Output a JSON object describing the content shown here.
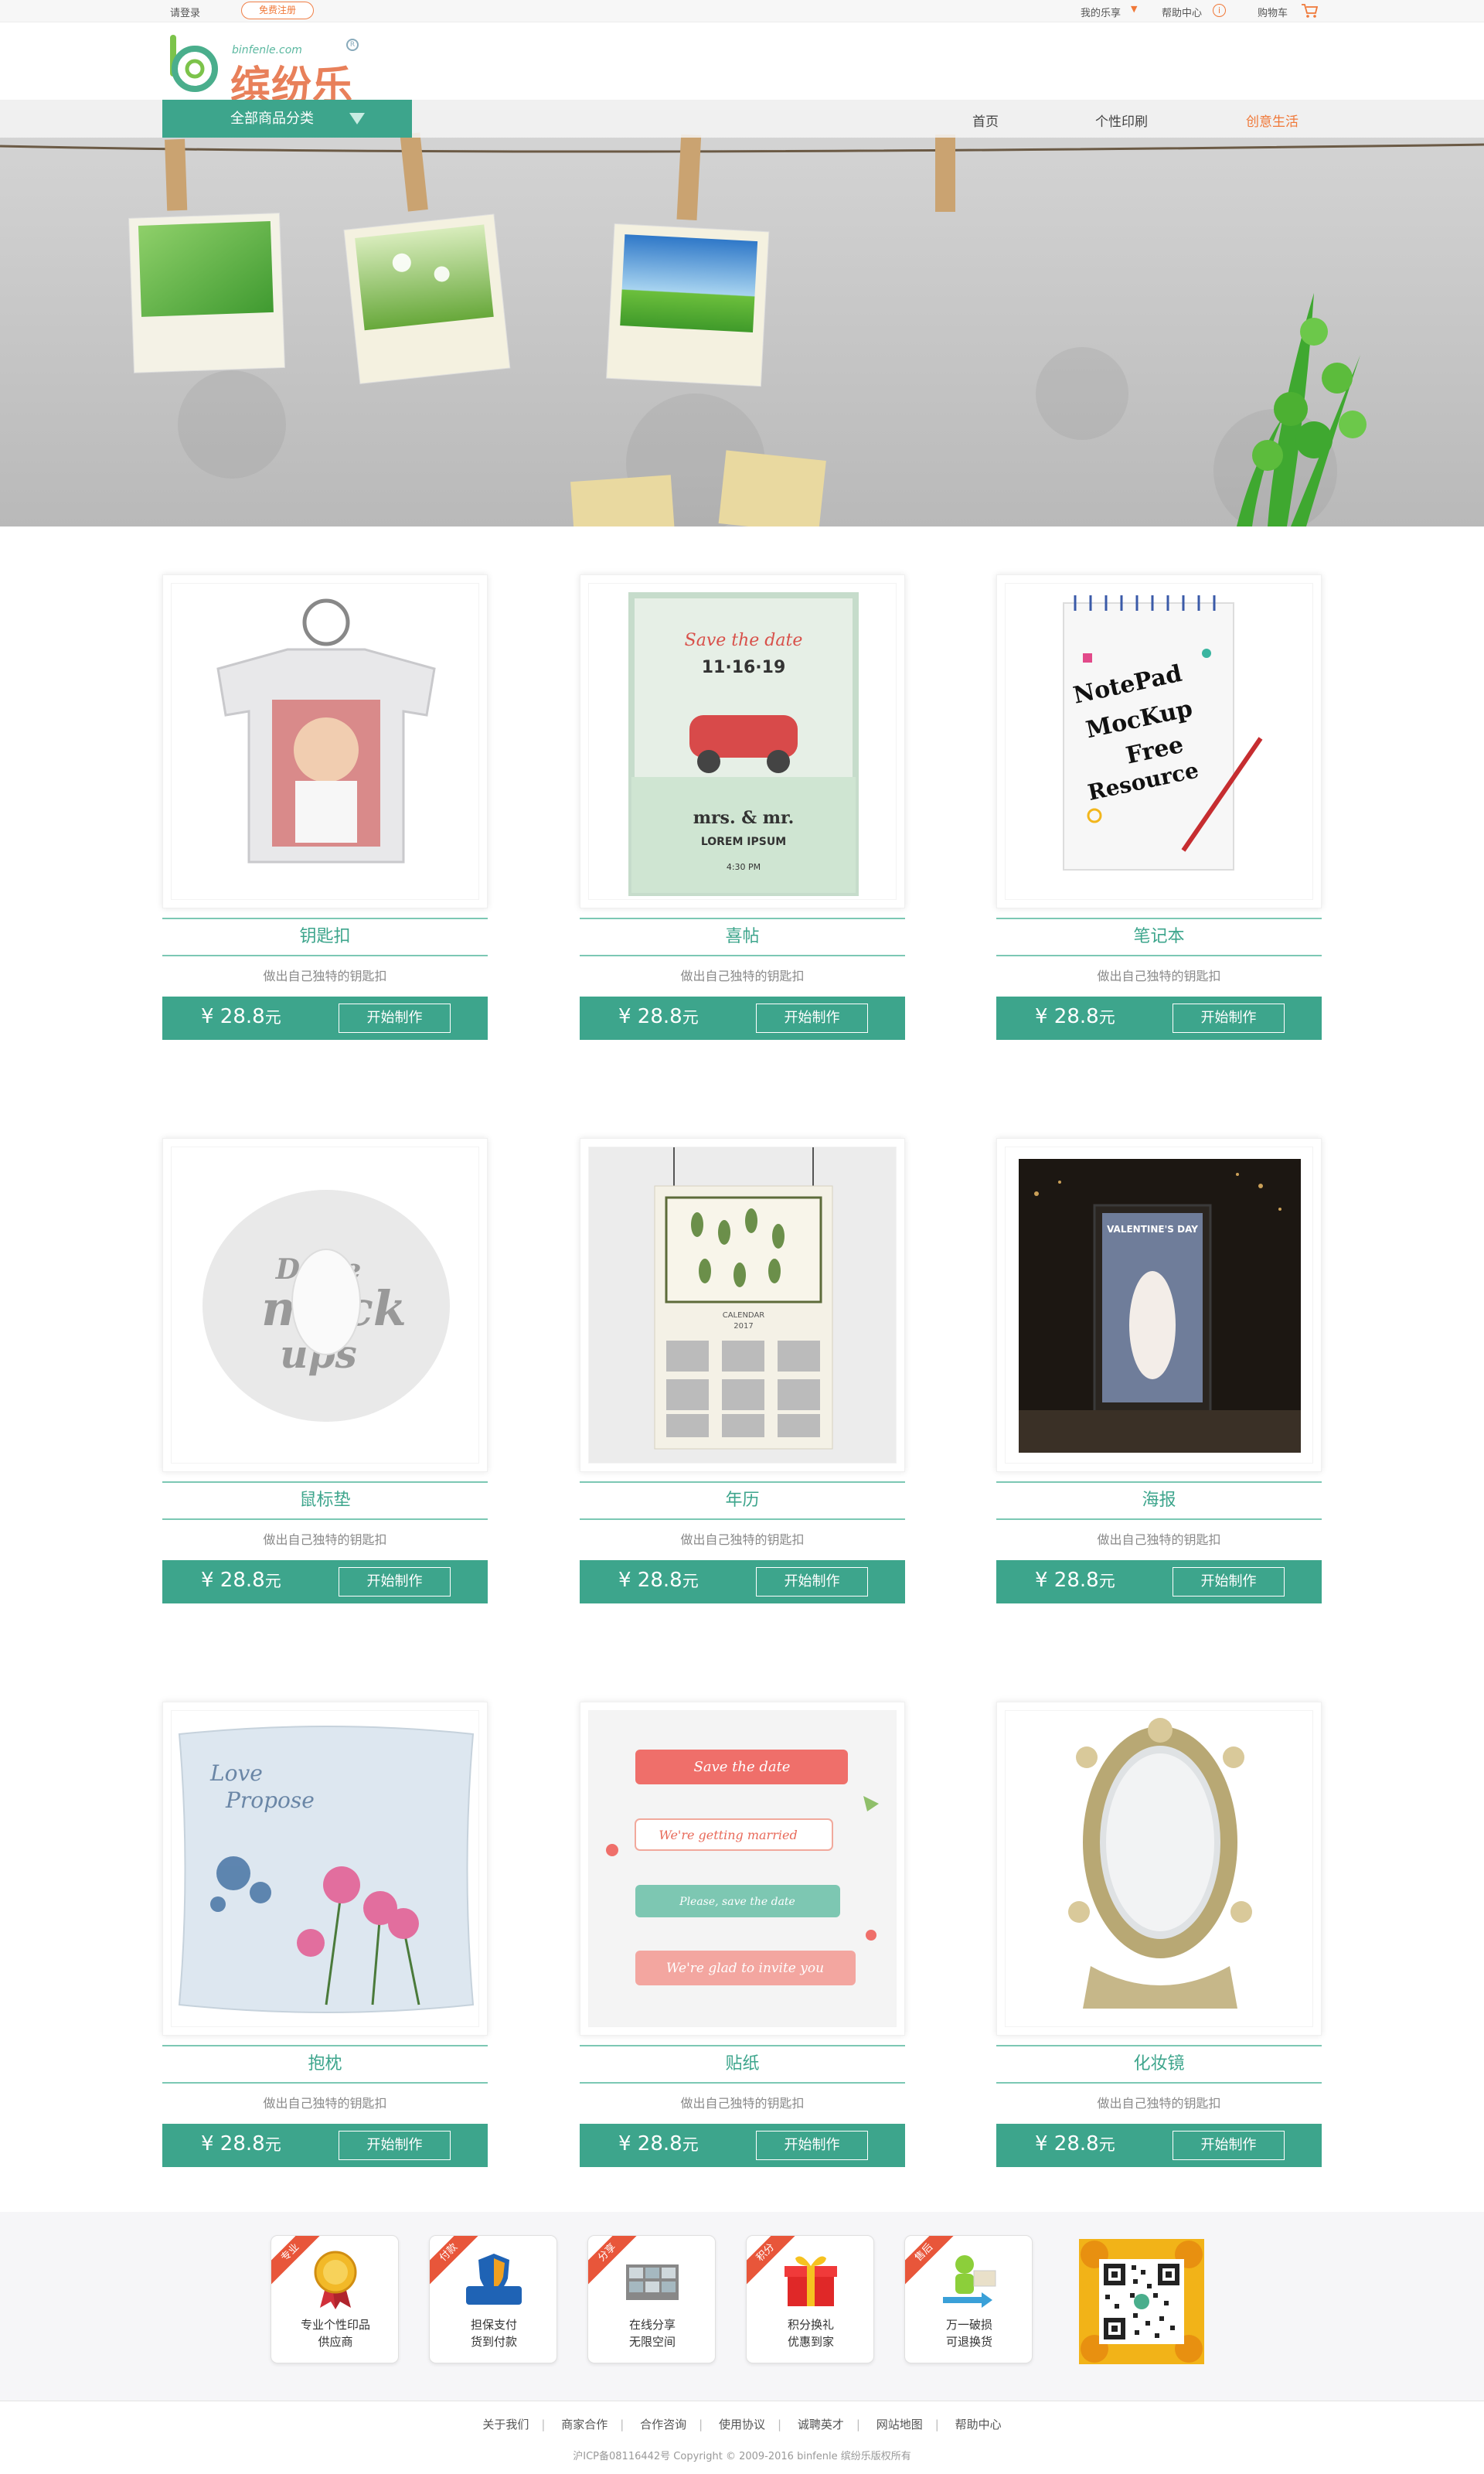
{
  "topbar": {
    "login": "请登录",
    "register": "免费注册",
    "my_account": "我的乐享",
    "help": "帮助中心",
    "cart": "购物车"
  },
  "logo": {
    "site": "binfenle.com",
    "name": "缤纷乐"
  },
  "nav": {
    "category_button": "全部商品分类",
    "links": [
      "首页",
      "个性印刷",
      "创意生活"
    ],
    "active_link": "创意生活"
  },
  "products": [
    {
      "name": "钥匙扣",
      "desc": "做出自己独特的钥匙扣",
      "price": "¥ 28.8",
      "unit": "元",
      "cta": "开始制作"
    },
    {
      "name": "喜帖",
      "desc": "做出自己独特的钥匙扣",
      "price": "¥ 28.8",
      "unit": "元",
      "cta": "开始制作"
    },
    {
      "name": "笔记本",
      "desc": "做出自己独特的钥匙扣",
      "price": "¥ 28.8",
      "unit": "元",
      "cta": "开始制作"
    },
    {
      "name": "鼠标垫",
      "desc": "做出自己独特的钥匙扣",
      "price": "¥ 28.8",
      "unit": "元",
      "cta": "开始制作"
    },
    {
      "name": "年历",
      "desc": "做出自己独特的钥匙扣",
      "price": "¥ 28.8",
      "unit": "元",
      "cta": "开始制作"
    },
    {
      "name": "海报",
      "desc": "做出自己独特的钥匙扣",
      "price": "¥ 28.8",
      "unit": "元",
      "cta": "开始制作"
    },
    {
      "name": "抱枕",
      "desc": "做出自己独特的钥匙扣",
      "price": "¥ 28.8",
      "unit": "元",
      "cta": "开始制作"
    },
    {
      "name": "贴纸",
      "desc": "做出自己独特的钥匙扣",
      "price": "¥ 28.8",
      "unit": "元",
      "cta": "开始制作"
    },
    {
      "name": "化妆镜",
      "desc": "做出自己独特的钥匙扣",
      "price": "¥ 28.8",
      "unit": "元",
      "cta": "开始制作"
    }
  ],
  "product_images": {
    "invitation": {
      "line1": "Save the date",
      "line2": "11·16·19",
      "line3": "mrs. & mr.",
      "line4": "LOREM   IPSUM",
      "line5": "4:30 PM"
    },
    "notebook": {
      "line1": "NotePad",
      "line2": "MocKup",
      "line3": "Free",
      "line4": "Resource"
    },
    "mousepad": {
      "line1": "De  ve",
      "line2": "mock",
      "line3": "ups"
    },
    "calendar": {
      "line1": "CALENDAR",
      "line2": "2017"
    },
    "poster": {
      "line1": "VALENTINE'S DAY"
    },
    "pillow": {
      "line1": "Love",
      "line2": "Propose"
    },
    "stickers": {
      "line1": "Save the date",
      "line2": "We're getting married",
      "line3": "Please, save the date",
      "line4": "We're glad to invite you"
    }
  },
  "features": [
    {
      "ribbon": "专业",
      "line1": "专业个性印品",
      "line2": "供应商",
      "icon": "medal-icon"
    },
    {
      "ribbon": "付款",
      "line1": "担保支付",
      "line2": "货到付款",
      "icon": "alipay-icon"
    },
    {
      "ribbon": "分享",
      "line1": "在线分享",
      "line2": "无限空间",
      "icon": "share-icon"
    },
    {
      "ribbon": "积分",
      "line1": "积分换礼",
      "line2": "优惠到家",
      "icon": "gift-icon"
    },
    {
      "ribbon": "售后",
      "line1": "万一破损",
      "line2": "可退换货",
      "icon": "return-icon"
    }
  ],
  "footer": {
    "links": [
      "关于我们",
      "商家合作",
      "合作咨询",
      "使用协议",
      "诚聘英才",
      "网站地图",
      "帮助中心"
    ],
    "copyright": "沪ICP备08116442号 Copyright © 2009-2016 binfenle 缤纷乐版权所有"
  },
  "colors": {
    "brand": "#3da58c",
    "accent": "#f07838"
  }
}
